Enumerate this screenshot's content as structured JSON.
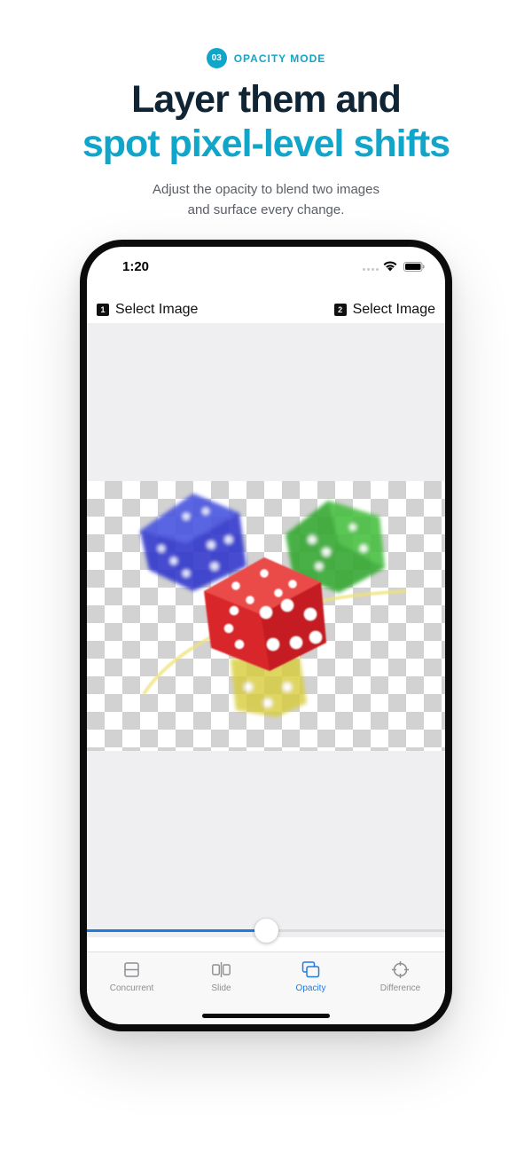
{
  "hero": {
    "step_number": "03",
    "mode_label": "OPACITY MODE",
    "headline_line1": "Layer them and",
    "headline_line2": "spot pixel-level shifts",
    "subtitle_line1": "Adjust the opacity to blend two images",
    "subtitle_line2": "and surface every change."
  },
  "status_bar": {
    "time": "1:20"
  },
  "image_selectors": [
    {
      "number": "1",
      "label": "Select Image"
    },
    {
      "number": "2",
      "label": "Select Image"
    }
  ],
  "opacity_slider": {
    "value_fraction": 0.5
  },
  "tabs": [
    {
      "label": "Concurrent",
      "icon": "concurrent-icon",
      "active": false
    },
    {
      "label": "Slide",
      "icon": "slide-icon",
      "active": false
    },
    {
      "label": "Opacity",
      "icon": "opacity-icon",
      "active": true
    },
    {
      "label": "Difference",
      "icon": "difference-icon",
      "active": false
    }
  ],
  "colors": {
    "accent": "#11a6c9",
    "headline": "#0f2535",
    "active_tab": "#1f7be0",
    "inactive_tab": "#8e8e93"
  }
}
